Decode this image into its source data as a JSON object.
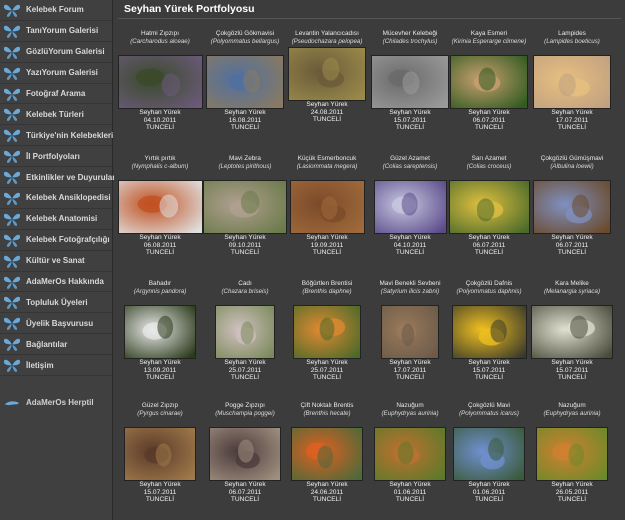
{
  "page": {
    "title": "Seyhan Yürek Portfolyosu"
  },
  "colors": {
    "butterfly": "#6aa9d8",
    "bg": "#3c3c3c"
  },
  "sidebar": {
    "items": [
      "Kelebek Forum",
      "TanıYorum Galerisi",
      "GözlüYorum Galerisi",
      "YazıYorum Galerisi",
      "Fotoğraf Arama",
      "Kelebek Türleri",
      "Türkiye'nin Kelebekleri",
      "İl Portfolyoları",
      "Etkinlikler ve Duyurular",
      "Kelebek Ansiklopedisi",
      "Kelebek Anatomisi",
      "Kelebek Fotoğrafçılığı",
      "Kültür ve Sanat",
      "AdaMerOs Hakkında",
      "Topluluk Üyeleri",
      "Üyelik Başvurusu",
      "Bağlantılar",
      "İletişim"
    ],
    "bottom": "AdaMerOs Herptil"
  },
  "gallery": [
    {
      "name": "Hatmi Zıpzıpı",
      "sci": "Carcharodus alceae",
      "author": "Seyhan Yürek",
      "date": "04.10.2011",
      "place": "TUNCELİ",
      "c1": "#6b5a7a",
      "c2": "#3a4a2a"
    },
    {
      "name": "Çokgözlü Gökmavisi",
      "sci": "Polyommatus bellargus",
      "author": "Seyhan Yürek",
      "date": "16.08.2011",
      "place": "TUNCELİ",
      "c1": "#8a7a60",
      "c2": "#5070a0"
    },
    {
      "name": "Levantin Yalancıcadısı",
      "sci": "Pseudochazara pelopea",
      "author": "Seyhan Yürek",
      "date": "24.08.2011",
      "place": "TUNCELİ",
      "c1": "#9a8a4a",
      "c2": "#6a5a3a"
    },
    {
      "name": "Mücevher Kelebeği",
      "sci": "Chilades trochylus",
      "author": "Seyhan Yürek",
      "date": "15.07.2011",
      "place": "TUNCELİ",
      "c1": "#9a9a9a",
      "c2": "#6a6a6a"
    },
    {
      "name": "Kaya Esmeri",
      "sci": "Kirinia Esperarge climene",
      "author": "Seyhan Yürek",
      "date": "06.07.2011",
      "place": "TUNCELİ",
      "c1": "#2f5a20",
      "c2": "#c8a070"
    },
    {
      "name": "Lampides",
      "sci": "Lampides boeticus",
      "author": "Seyhan Yürek",
      "date": "17.07.2011",
      "place": "TUNCELİ",
      "c1": "#c0a080",
      "c2": "#e8c080"
    },
    {
      "name": "Yırtık pırtık",
      "sci": "Nymphalis c-album",
      "author": "Seyhan Yürek",
      "date": "06.08.2011",
      "place": "TUNCELİ",
      "c1": "#e0e0e0",
      "c2": "#c05020"
    },
    {
      "name": "Mavi Zebra",
      "sci": "Leptotes pirithous",
      "author": "Seyhan Yürek",
      "date": "09.10.2011",
      "place": "TUNCELİ",
      "c1": "#6a7a4a",
      "c2": "#b0a090"
    },
    {
      "name": "Küçük Esmerboncuk",
      "sci": "Lasiommata megera",
      "author": "Seyhan Yürek",
      "date": "19.09.2011",
      "place": "TUNCELİ",
      "c1": "#a06a3a",
      "c2": "#7a4a2a"
    },
    {
      "name": "Güzel Azamet",
      "sci": "Colias sareptensis",
      "author": "Seyhan Yürek",
      "date": "04.10.2011",
      "place": "TUNCELİ",
      "c1": "#5a4a8a",
      "c2": "#c8c8e0"
    },
    {
      "name": "Sarı Azamet",
      "sci": "Colias croceus",
      "author": "Seyhan Yürek",
      "date": "06.07.2011",
      "place": "TUNCELİ",
      "c1": "#4a6a2a",
      "c2": "#e0c040"
    },
    {
      "name": "Çokgözlü Gümüşmavi",
      "sci": "Albulina loewii",
      "author": "Seyhan Yürek",
      "date": "06.07.2011",
      "place": "TUNCELİ",
      "c1": "#6a4a2a",
      "c2": "#8090c0"
    },
    {
      "name": "Bahadır",
      "sci": "Argynnis pandora",
      "author": "Seyhan Yürek",
      "date": "13.09.2011",
      "place": "TUNCELİ",
      "c1": "#2a3a1a",
      "c2": "#e8e8e8"
    },
    {
      "name": "Cadı",
      "sci": "Chazara briseis",
      "author": "Seyhan Yürek",
      "date": "25.07.2011",
      "place": "TUNCELİ",
      "c1": "#7a8a5a",
      "c2": "#d0c0c0"
    },
    {
      "name": "Böğürtlen Brentisi",
      "sci": "Brenthis daphne",
      "author": "Seyhan Yürek",
      "date": "25.07.2011",
      "place": "TUNCELİ",
      "c1": "#4a6a2a",
      "c2": "#e08a30"
    },
    {
      "name": "Mavi Benekli Sevbeni",
      "sci": "Satyrium ilicis zabni",
      "author": "Seyhan Yürek",
      "date": "17.07.2011",
      "place": "TUNCELİ",
      "c1": "#6a5a4a",
      "c2": "#9a7a5a"
    },
    {
      "name": "Çokgözlü Dafnis",
      "sci": "Polyommatus daphnis",
      "author": "Seyhan Yürek",
      "date": "15.07.2011",
      "place": "TUNCELİ",
      "c1": "#3a3a2a",
      "c2": "#f0c020"
    },
    {
      "name": "Kara Melike",
      "sci": "Melanargia syriaca",
      "author": "Seyhan Yürek",
      "date": "15.07.2011",
      "place": "TUNCELİ",
      "c1": "#4a4a3a",
      "c2": "#e0e0d0"
    },
    {
      "name": "Güzel Zıpzıp",
      "sci": "Pyrgus cinarae",
      "author": "Seyhan Yürek",
      "date": "15.07.2011",
      "place": "TUNCELİ",
      "c1": "#a07a4a",
      "c2": "#5a3a2a"
    },
    {
      "name": "Pogge Zıpzıpı",
      "sci": "Muschampia poggei",
      "author": "Seyhan Yürek",
      "date": "06.07.2011",
      "place": "TUNCELİ",
      "c1": "#a09080",
      "c2": "#4a3a3a"
    },
    {
      "name": "Çift Noktalı Brentis",
      "sci": "Brenthis hecate",
      "author": "Seyhan Yürek",
      "date": "24.06.2011",
      "place": "TUNCELİ",
      "c1": "#4a6a3a",
      "c2": "#e06020"
    },
    {
      "name": "Nazuğum",
      "sci": "Euphydryas aurinia",
      "author": "Seyhan Yürek",
      "date": "01.06.2011",
      "place": "TUNCELİ",
      "c1": "#5a7a2a",
      "c2": "#c07030"
    },
    {
      "name": "Çokgözlü Mavi",
      "sci": "Polyommatus icarus",
      "author": "Seyhan Yürek",
      "date": "01.06.2011",
      "place": "TUNCELİ",
      "c1": "#3a5a3a",
      "c2": "#7090d0"
    },
    {
      "name": "Nazuğum",
      "sci": "Euphydryas aurinia",
      "author": "Seyhan Yürek",
      "date": "26.05.2011",
      "place": "TUNCELİ",
      "c1": "#6a8a2a",
      "c2": "#d08030"
    }
  ]
}
